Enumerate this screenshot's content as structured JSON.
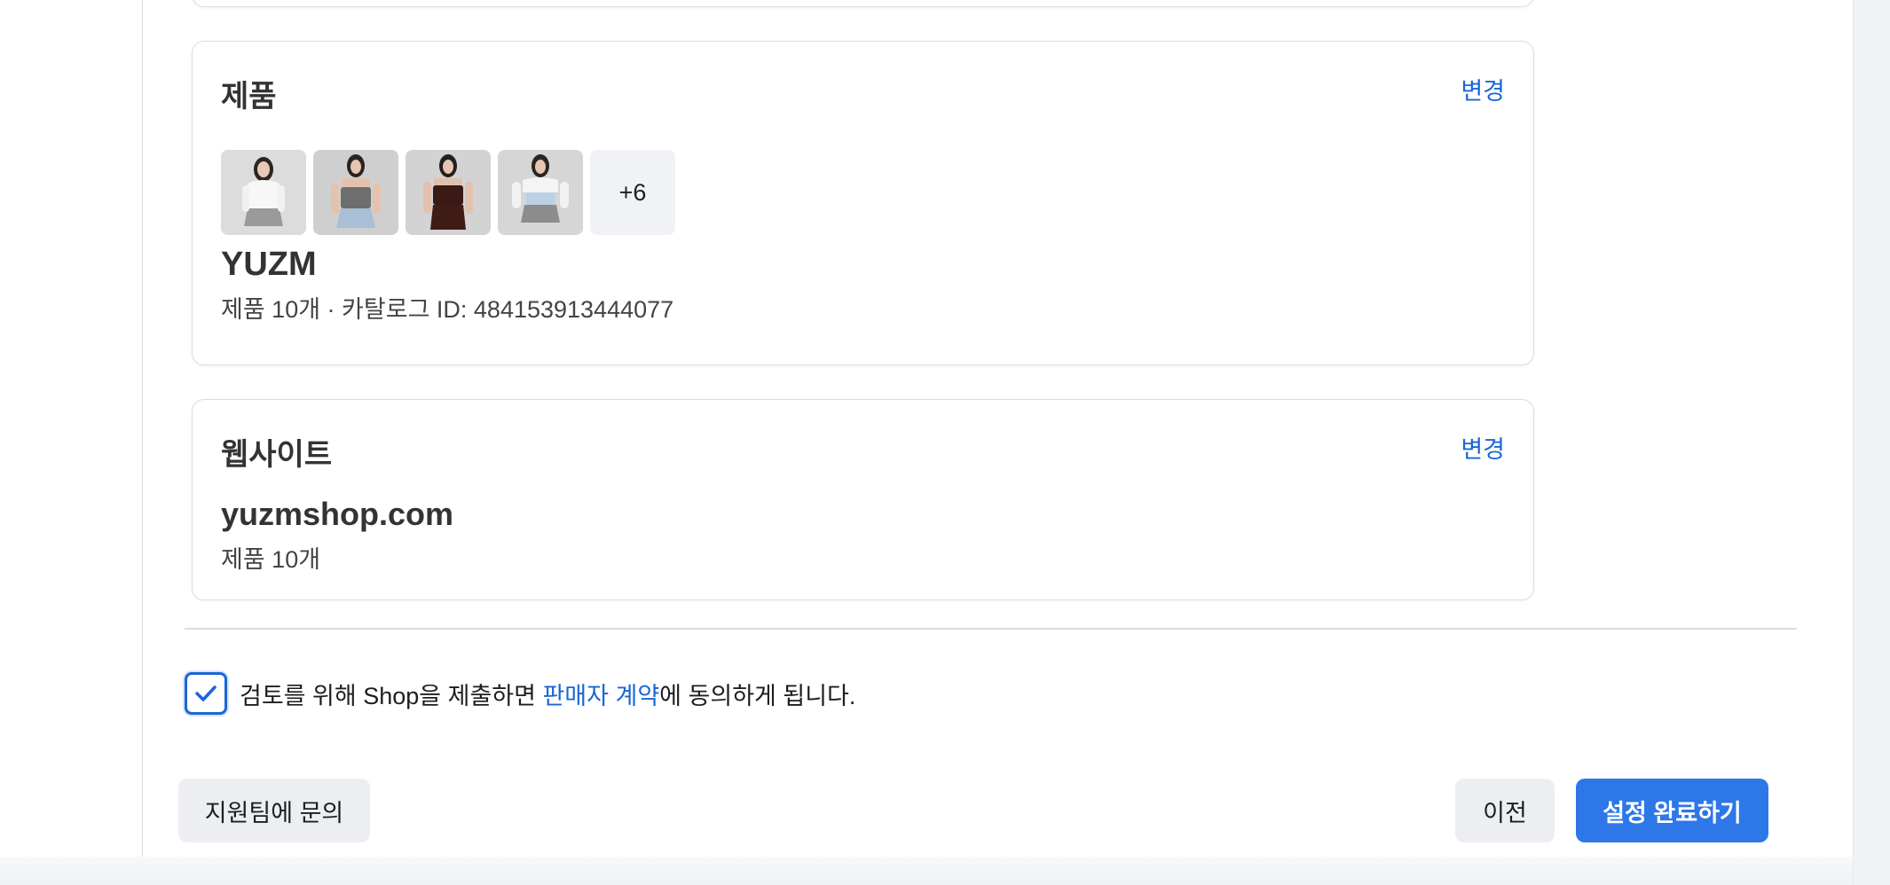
{
  "products_card": {
    "title": "제품",
    "change_label": "변경",
    "thumbnails": [
      {
        "name": "white long-sleeve top with grey skirt"
      },
      {
        "name": "grey tube top with denim skirt"
      },
      {
        "name": "dark brown tube top and skirt set"
      },
      {
        "name": "white bolero with grey mini skirt"
      }
    ],
    "more_count": "+6",
    "catalog_name": "YUZM",
    "catalog_meta": "제품 10개 · 카탈로그 ID: 484153913444077"
  },
  "website_card": {
    "title": "웹사이트",
    "change_label": "변경",
    "domain": "yuzmshop.com",
    "meta": "제품 10개"
  },
  "agreement": {
    "checked": true,
    "text_before": "검토를 위해 Shop을 제출하면 ",
    "link_text": "판매자 계약",
    "text_after": "에 동의하게 됩니다."
  },
  "footer": {
    "support_label": "지원팀에 문의",
    "prev_label": "이전",
    "finish_label": "설정 완료하기"
  },
  "colors": {
    "accent": "#2d77e8",
    "link": "#1a66d6"
  }
}
